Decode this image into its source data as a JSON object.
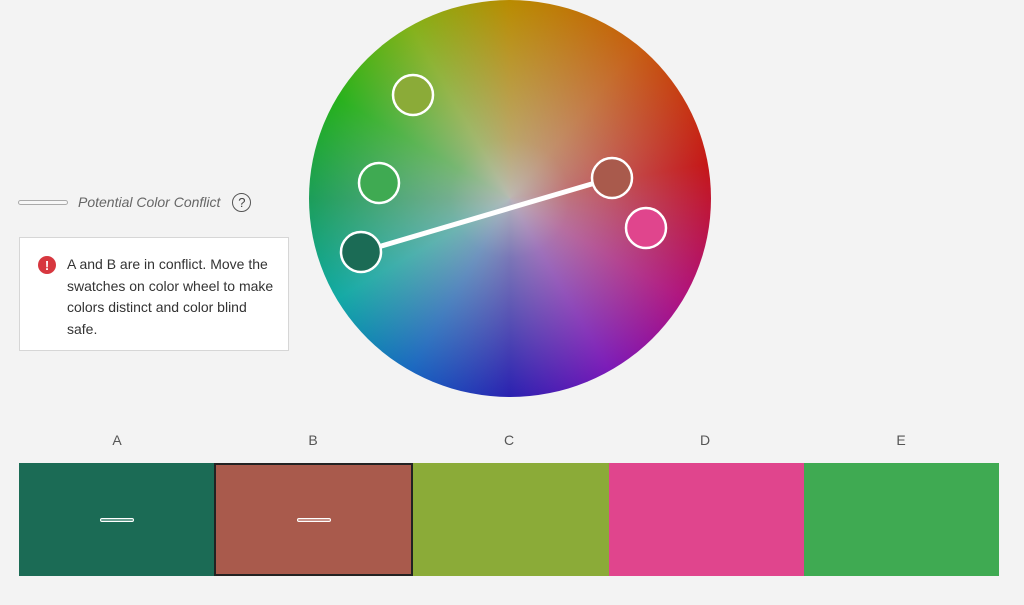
{
  "legend": {
    "label": "Potential Color Conflict",
    "help_symbol": "?"
  },
  "alert": {
    "icon": "error-icon",
    "icon_symbol": "!",
    "message": "A and B are in conflict. Move the swatches on color wheel to make colors distinct and color blind safe."
  },
  "wheel": {
    "handles": [
      {
        "name": "A",
        "color": "#1b6b55"
      },
      {
        "name": "B",
        "color": "#a95a4c"
      },
      {
        "name": "C",
        "color": "#8bab38"
      },
      {
        "name": "D",
        "color": "#e0458d"
      },
      {
        "name": "E",
        "color": "#3faa52"
      }
    ],
    "conflict_pair": [
      "A",
      "B"
    ]
  },
  "swatches": [
    {
      "label": "A",
      "color": "#1b6b55",
      "conflict": true
    },
    {
      "label": "B",
      "color": "#a95a4c",
      "conflict": true,
      "selected": true
    },
    {
      "label": "C",
      "color": "#8bab38",
      "conflict": false
    },
    {
      "label": "D",
      "color": "#e0458d",
      "conflict": false
    },
    {
      "label": "E",
      "color": "#3faa52",
      "conflict": false
    }
  ]
}
